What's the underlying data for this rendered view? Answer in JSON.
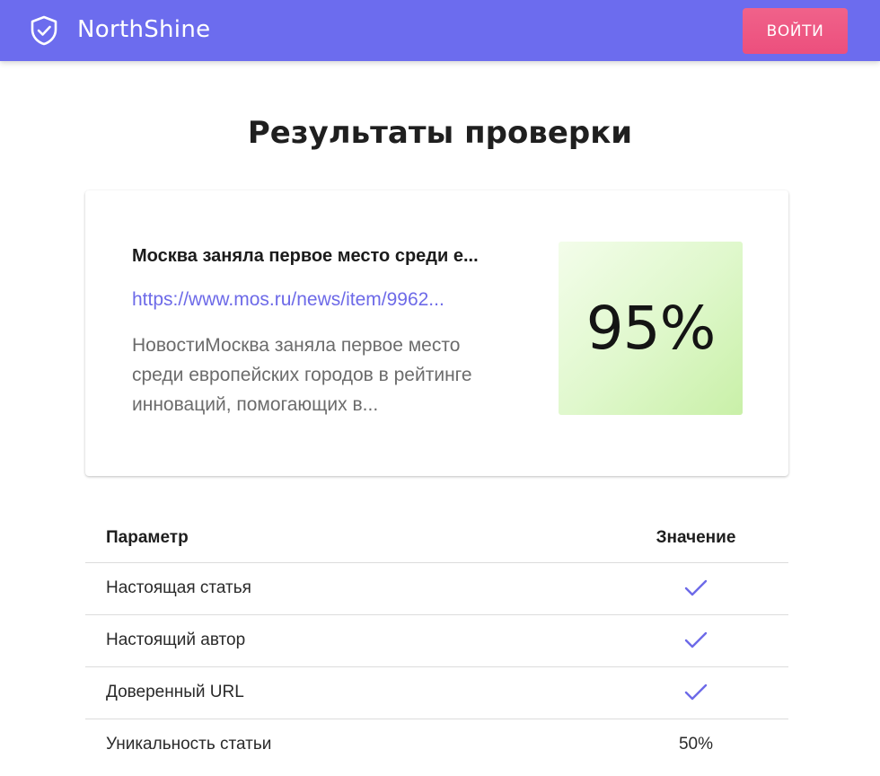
{
  "header": {
    "brand": "NorthShine",
    "login_label": "ВОЙТИ",
    "logo_icon": "shield-check-icon",
    "background_color": "#6c6cee",
    "login_color": "#ec4f7d"
  },
  "page": {
    "title": "Результаты проверки"
  },
  "result": {
    "article_title": "Москва заняла первое место среди е...",
    "url": "https://www.mos.ru/news/item/9962...",
    "excerpt": "НовостиМосква заняла первое место среди европейских городов в рейтинге инноваций, помогающих в...",
    "score": "95%",
    "score_color": "#c9f0a8"
  },
  "params": {
    "headers": [
      "Параметр",
      "Значение"
    ],
    "rows": [
      {
        "name": "Настоящая статья",
        "value": "",
        "value_icon": "check-icon"
      },
      {
        "name": "Настоящий автор",
        "value": "",
        "value_icon": "check-icon"
      },
      {
        "name": "Доверенный URL",
        "value": "",
        "value_icon": "check-icon"
      },
      {
        "name": "Уникальность статьи",
        "value": "50%",
        "value_icon": ""
      }
    ],
    "check_color": "#6d6ae8"
  }
}
